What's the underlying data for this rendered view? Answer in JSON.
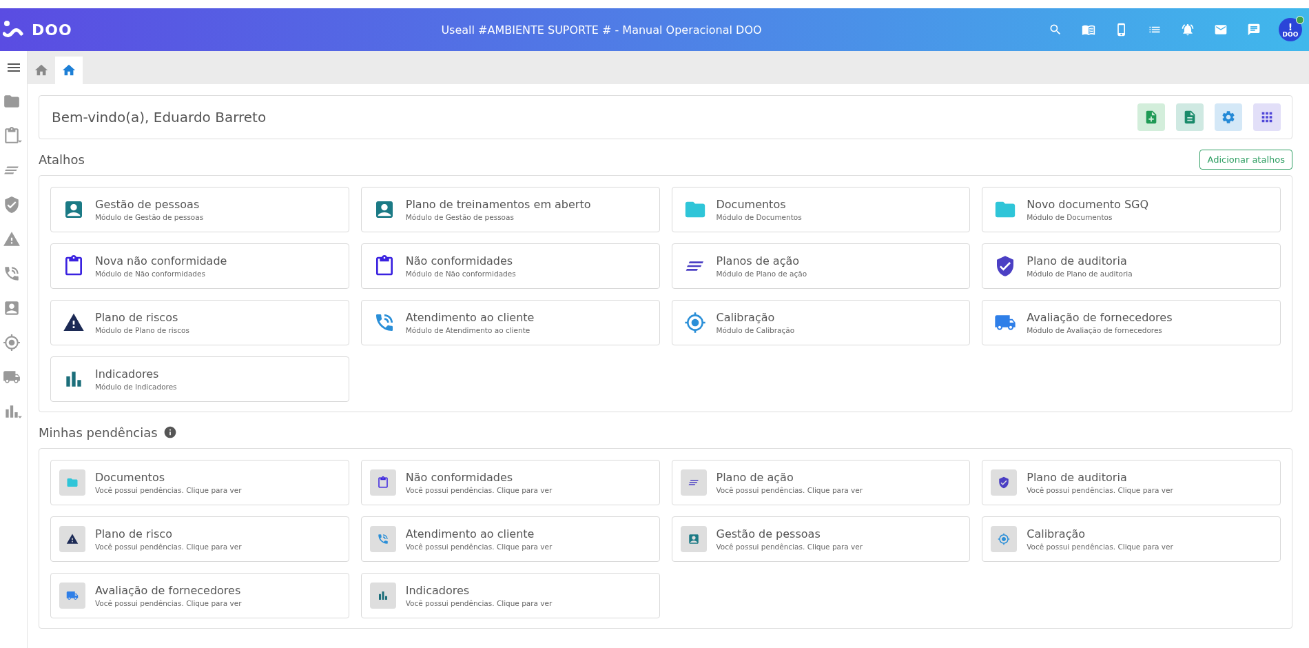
{
  "header": {
    "logo_text": "DOO",
    "title": "Useall #AMBIENTE SUPORTE # - Manual Operacional DOO",
    "avatar": {
      "badge": "!",
      "text": "DOO",
      "online": true
    }
  },
  "tabs": [
    {
      "selected": false
    },
    {
      "selected": true
    }
  ],
  "sidebar": {
    "items": [
      {
        "kind": "folder",
        "has_submenu": false
      },
      {
        "kind": "clipboard",
        "has_submenu": true
      },
      {
        "kind": "lines",
        "has_submenu": false
      },
      {
        "kind": "shield",
        "has_submenu": false
      },
      {
        "kind": "warning",
        "has_submenu": false
      },
      {
        "kind": "phone",
        "has_submenu": false
      },
      {
        "kind": "person",
        "has_submenu": false
      },
      {
        "kind": "target",
        "has_submenu": false
      },
      {
        "kind": "truck",
        "has_submenu": false
      },
      {
        "kind": "chart",
        "has_submenu": true
      }
    ]
  },
  "welcome": {
    "text": "Bem-vindo(a), Eduardo Barreto",
    "actions": [
      {
        "kind": "new-doc"
      },
      {
        "kind": "doc"
      },
      {
        "kind": "settings"
      },
      {
        "kind": "apps"
      }
    ]
  },
  "shortcuts": {
    "title": "Atalhos",
    "add_button": "Adicionar atalhos",
    "items": [
      {
        "kind": "person",
        "title": "Gestão de pessoas",
        "subtitle": "Módulo de Gestão de pessoas"
      },
      {
        "kind": "person",
        "title": "Plano de treinamentos em aberto",
        "subtitle": "Módulo de Gestão de pessoas"
      },
      {
        "kind": "folder",
        "title": "Documentos",
        "subtitle": "Módulo de Documentos"
      },
      {
        "kind": "folder",
        "title": "Novo documento SGQ",
        "subtitle": "Módulo de Documentos"
      },
      {
        "kind": "clipboard",
        "title": "Nova não conformidade",
        "subtitle": "Módulo de Não conformidades"
      },
      {
        "kind": "clipboard",
        "title": "Não conformidades",
        "subtitle": "Módulo de Não conformidades"
      },
      {
        "kind": "lines",
        "title": "Planos de ação",
        "subtitle": "Módulo de Plano de ação"
      },
      {
        "kind": "shield",
        "title": "Plano de auditoria",
        "subtitle": "Módulo de Plano de auditoria"
      },
      {
        "kind": "warning",
        "title": "Plano de riscos",
        "subtitle": "Módulo de Plano de riscos"
      },
      {
        "kind": "phone",
        "title": "Atendimento ao cliente",
        "subtitle": "Módulo de Atendimento ao cliente"
      },
      {
        "kind": "target",
        "title": "Calibração",
        "subtitle": "Módulo de Calibração"
      },
      {
        "kind": "truck",
        "title": "Avaliação de fornecedores",
        "subtitle": "Módulo de Avaliação de fornecedores"
      },
      {
        "kind": "chart",
        "title": "Indicadores",
        "subtitle": "Módulo de Indicadores"
      }
    ]
  },
  "pending": {
    "title": "Minhas pendências",
    "items": [
      {
        "kind": "folder",
        "title": "Documentos",
        "subtitle": "Você possui pendências. Clique para ver"
      },
      {
        "kind": "clipboard",
        "title": "Não conformidades",
        "subtitle": "Você possui pendências. Clique para ver"
      },
      {
        "kind": "lines",
        "title": "Plano de ação",
        "subtitle": "Você possui pendências. Clique para ver"
      },
      {
        "kind": "shield",
        "title": "Plano de auditoria",
        "subtitle": "Você possui pendências. Clique para ver"
      },
      {
        "kind": "warning",
        "title": "Plano de risco",
        "subtitle": "Você possui pendências. Clique para ver"
      },
      {
        "kind": "phone",
        "title": "Atendimento ao cliente",
        "subtitle": "Você possui pendências. Clique para ver"
      },
      {
        "kind": "person",
        "title": "Gestão de pessoas",
        "subtitle": "Você possui pendências. Clique para ver"
      },
      {
        "kind": "target",
        "title": "Calibração",
        "subtitle": "Você possui pendências. Clique para ver"
      },
      {
        "kind": "truck",
        "title": "Avaliação de fornecedores",
        "subtitle": "Você possui pendências. Clique para ver"
      },
      {
        "kind": "chart",
        "title": "Indicadores",
        "subtitle": "Você possui pendências. Clique para ver"
      }
    ]
  }
}
